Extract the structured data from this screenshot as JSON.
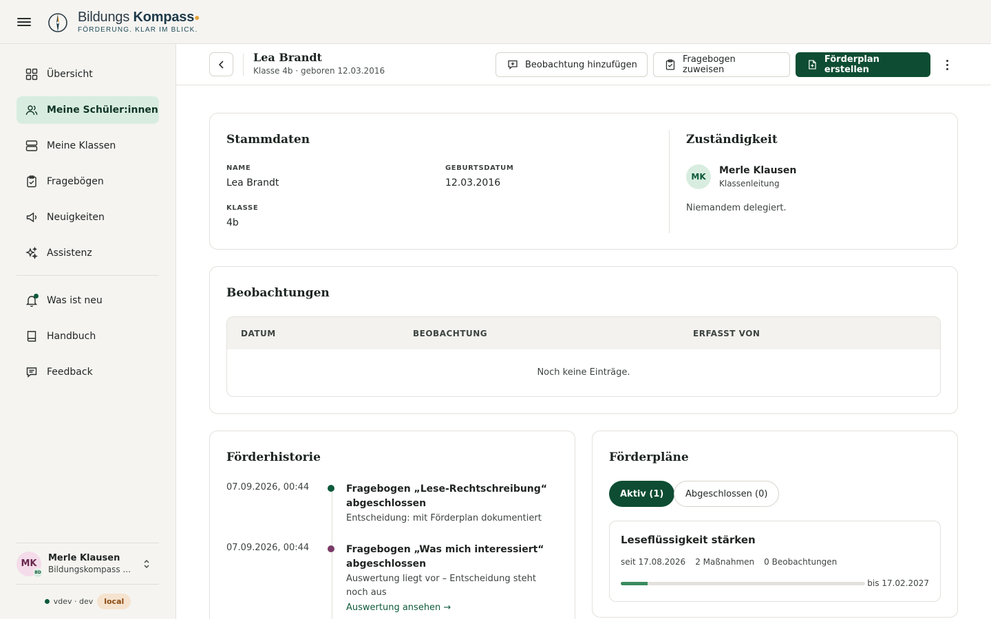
{
  "app": {
    "brand_name_light": "Bildungs ",
    "brand_name_bold": "Kompass",
    "brand_tagline": "FÖRDERUNG. KLAR IM BLICK."
  },
  "sidebar": {
    "items": [
      {
        "label": "Übersicht",
        "icon": "grid-icon"
      },
      {
        "label": "Meine Schüler:innen",
        "icon": "users-icon",
        "active": true
      },
      {
        "label": "Meine Klassen",
        "icon": "server-icon"
      },
      {
        "label": "Fragebögen",
        "icon": "clipboard-check-icon"
      },
      {
        "label": "Neuigkeiten",
        "icon": "megaphone-icon"
      },
      {
        "label": "Assistenz",
        "icon": "sparkles-icon"
      }
    ],
    "secondary_items": [
      {
        "label": "Was ist neu",
        "icon": "bell-icon"
      },
      {
        "label": "Handbuch",
        "icon": "book-icon"
      },
      {
        "label": "Feedback",
        "icon": "message-icon"
      }
    ],
    "user": {
      "initials": "MK",
      "badge": "BD",
      "name": "Merle Klausen",
      "org": "Bildungskompass ..."
    },
    "env": {
      "label": "vdev · dev",
      "badge": "local"
    }
  },
  "header": {
    "title": "Lea Brandt",
    "subtitle": "Klasse 4b · geboren 12.03.2016",
    "btn_observation": "Beobachtung hinzufügen",
    "btn_questionnaire": "Fragebogen zuweisen",
    "btn_plan": "Förderplan erstellen"
  },
  "stammdaten": {
    "title": "Stammdaten",
    "name_label": "NAME",
    "name_value": "Lea Brandt",
    "birth_label": "GEBURTSDATUM",
    "birth_value": "12.03.2016",
    "class_label": "KLASSE",
    "class_value": "4b"
  },
  "zustaendigkeit": {
    "title": "Zuständigkeit",
    "initials": "MK",
    "name": "Merle Klausen",
    "role": "Klassenleitung",
    "delegation": "Niemandem delegiert."
  },
  "beobachtungen": {
    "title": "Beobachtungen",
    "columns": [
      "DATUM",
      "BEOBACHTUNG",
      "ERFASST VON"
    ],
    "empty": "Noch keine Einträge."
  },
  "historie": {
    "title": "Förderhistorie",
    "entries": [
      {
        "date": "07.09.2026, 00:44",
        "title": "Fragebogen „Lese-Rechtschreibung“ abgeschlossen",
        "detail": "Entscheidung: mit Förderplan dokumentiert",
        "dot_color": "#0e5a3a"
      },
      {
        "date": "07.09.2026, 00:44",
        "title": "Fragebogen „Was mich interessiert“ abgeschlossen",
        "detail": "Auswertung liegt vor – Entscheidung steht noch aus",
        "link": "Auswertung ansehen →",
        "dot_color": "#7a3a66"
      }
    ]
  },
  "foerderplaene": {
    "title": "Förderpläne",
    "tab_active": "Aktiv (1)",
    "tab_closed": "Abgeschlossen (0)",
    "plan": {
      "title": "Leseflüssigkeit stärken",
      "since": "seit 17.08.2026",
      "measures": "2 Maßnahmen",
      "observations": "0 Beobachtungen",
      "until": "bis 17.02.2027",
      "progress": 0.11
    }
  }
}
